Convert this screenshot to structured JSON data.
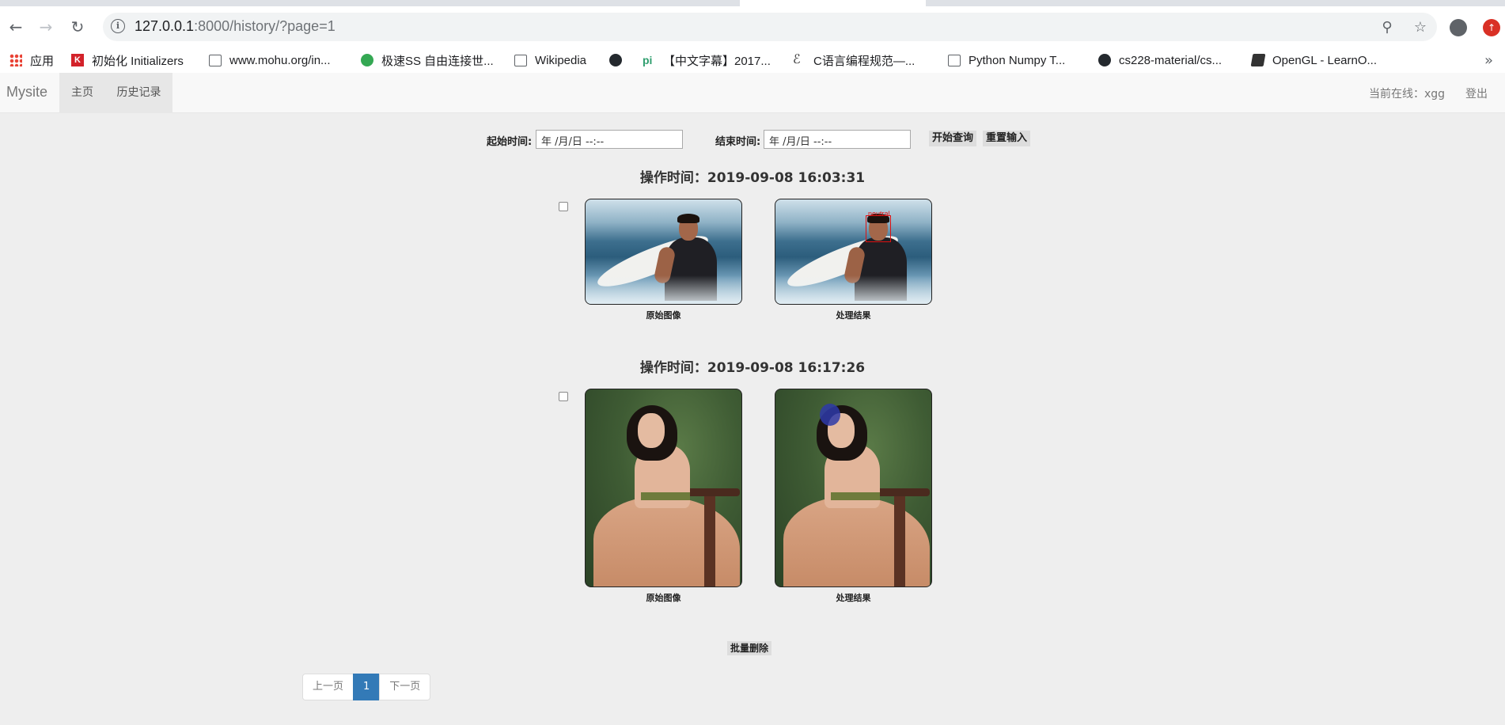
{
  "browser": {
    "url_host": "127.0.0.1",
    "url_rest": ":8000/history/?page=1",
    "bookmarks": [
      {
        "label": "应用",
        "icon": "apps-grid-icon"
      },
      {
        "label": "初始化 Initializers",
        "icon": "k-logo-icon"
      },
      {
        "label": "www.mohu.org/in...",
        "icon": "document-icon"
      },
      {
        "label": "极速SS 自由连接世...",
        "icon": "paper-plane-icon"
      },
      {
        "label": "Wikipedia",
        "icon": "document-icon"
      },
      {
        "label": "",
        "icon": "github-icon"
      },
      {
        "label": "【中文字幕】2017...",
        "icon": "pi-logo-icon"
      },
      {
        "label": "C语言编程规范—...",
        "icon": "c-logo-icon"
      },
      {
        "label": "Python Numpy T...",
        "icon": "document-icon"
      },
      {
        "label": "cs228-material/cs...",
        "icon": "github-icon"
      },
      {
        "label": "OpenGL - LearnO...",
        "icon": "book-icon"
      }
    ],
    "more_glyph": "»"
  },
  "navbar": {
    "brand": "Mysite",
    "items": [
      "主页",
      "历史记录"
    ],
    "online_user": "当前在线：xgg",
    "logout": "登出"
  },
  "query": {
    "start_label": "起始时间:",
    "start_value": "年 /月/日  --:--",
    "end_label": "结束时间:",
    "end_value": "年 /月/日  --:--",
    "search_button": "开始查询",
    "reset_button": "重置输入"
  },
  "records": [
    {
      "title": "操作时间：2019-09-08 16:03:31",
      "original_caption": "原始图像",
      "result_caption": "处理结果",
      "emotion_label": "neutral"
    },
    {
      "title": "操作时间：2019-09-08 16:17:26",
      "original_caption": "原始图像",
      "result_caption": "处理结果"
    }
  ],
  "batch_delete": "批量删除",
  "pagination": {
    "prev": "上一页",
    "current": "1",
    "next": "下一页"
  },
  "colors": {
    "accent": "#337ab7",
    "background": "#eeeeee",
    "navbar": "#f8f8f8"
  }
}
